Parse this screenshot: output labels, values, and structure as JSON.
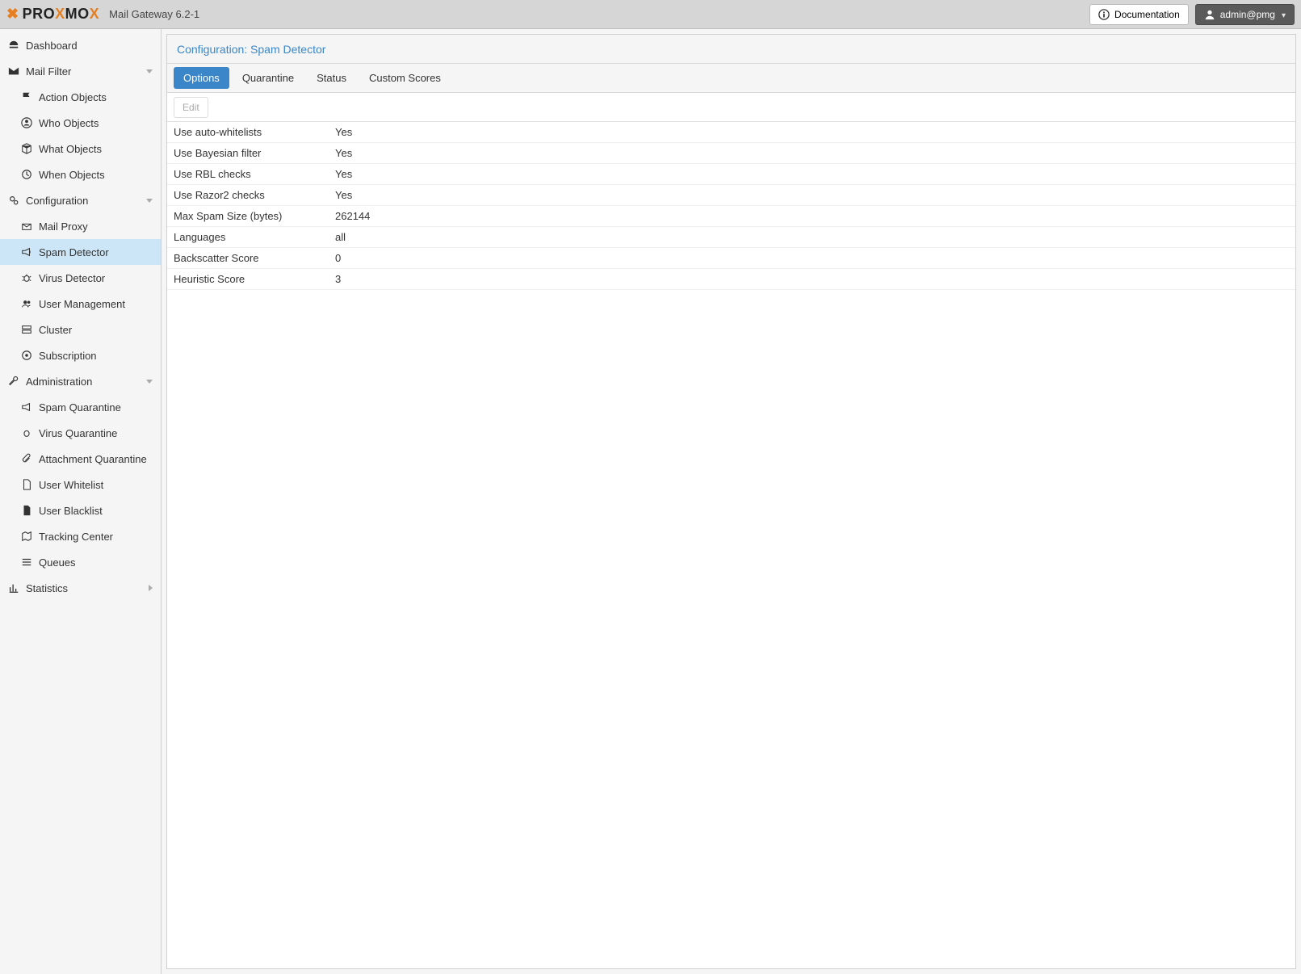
{
  "header": {
    "product": "Mail Gateway 6.2-1",
    "doc_label": "Documentation",
    "user_label": "admin@pmg"
  },
  "sidebar": {
    "dashboard": "Dashboard",
    "mail_filter": "Mail Filter",
    "action_objects": "Action Objects",
    "who_objects": "Who Objects",
    "what_objects": "What Objects",
    "when_objects": "When Objects",
    "configuration": "Configuration",
    "mail_proxy": "Mail Proxy",
    "spam_detector": "Spam Detector",
    "virus_detector": "Virus Detector",
    "user_management": "User Management",
    "cluster": "Cluster",
    "subscription": "Subscription",
    "administration": "Administration",
    "spam_quarantine": "Spam Quarantine",
    "virus_quarantine": "Virus Quarantine",
    "attachment_quarantine": "Attachment Quarantine",
    "user_whitelist": "User Whitelist",
    "user_blacklist": "User Blacklist",
    "tracking_center": "Tracking Center",
    "queues": "Queues",
    "statistics": "Statistics"
  },
  "panel": {
    "title": "Configuration: Spam Detector",
    "tabs": {
      "options": "Options",
      "quarantine": "Quarantine",
      "status": "Status",
      "custom_scores": "Custom Scores"
    },
    "toolbar": {
      "edit": "Edit"
    },
    "rows": [
      {
        "k": "Use auto-whitelists",
        "v": "Yes"
      },
      {
        "k": "Use Bayesian filter",
        "v": "Yes"
      },
      {
        "k": "Use RBL checks",
        "v": "Yes"
      },
      {
        "k": "Use Razor2 checks",
        "v": "Yes"
      },
      {
        "k": "Max Spam Size (bytes)",
        "v": "262144"
      },
      {
        "k": "Languages",
        "v": "all"
      },
      {
        "k": "Backscatter Score",
        "v": "0"
      },
      {
        "k": "Heuristic Score",
        "v": "3"
      }
    ]
  }
}
